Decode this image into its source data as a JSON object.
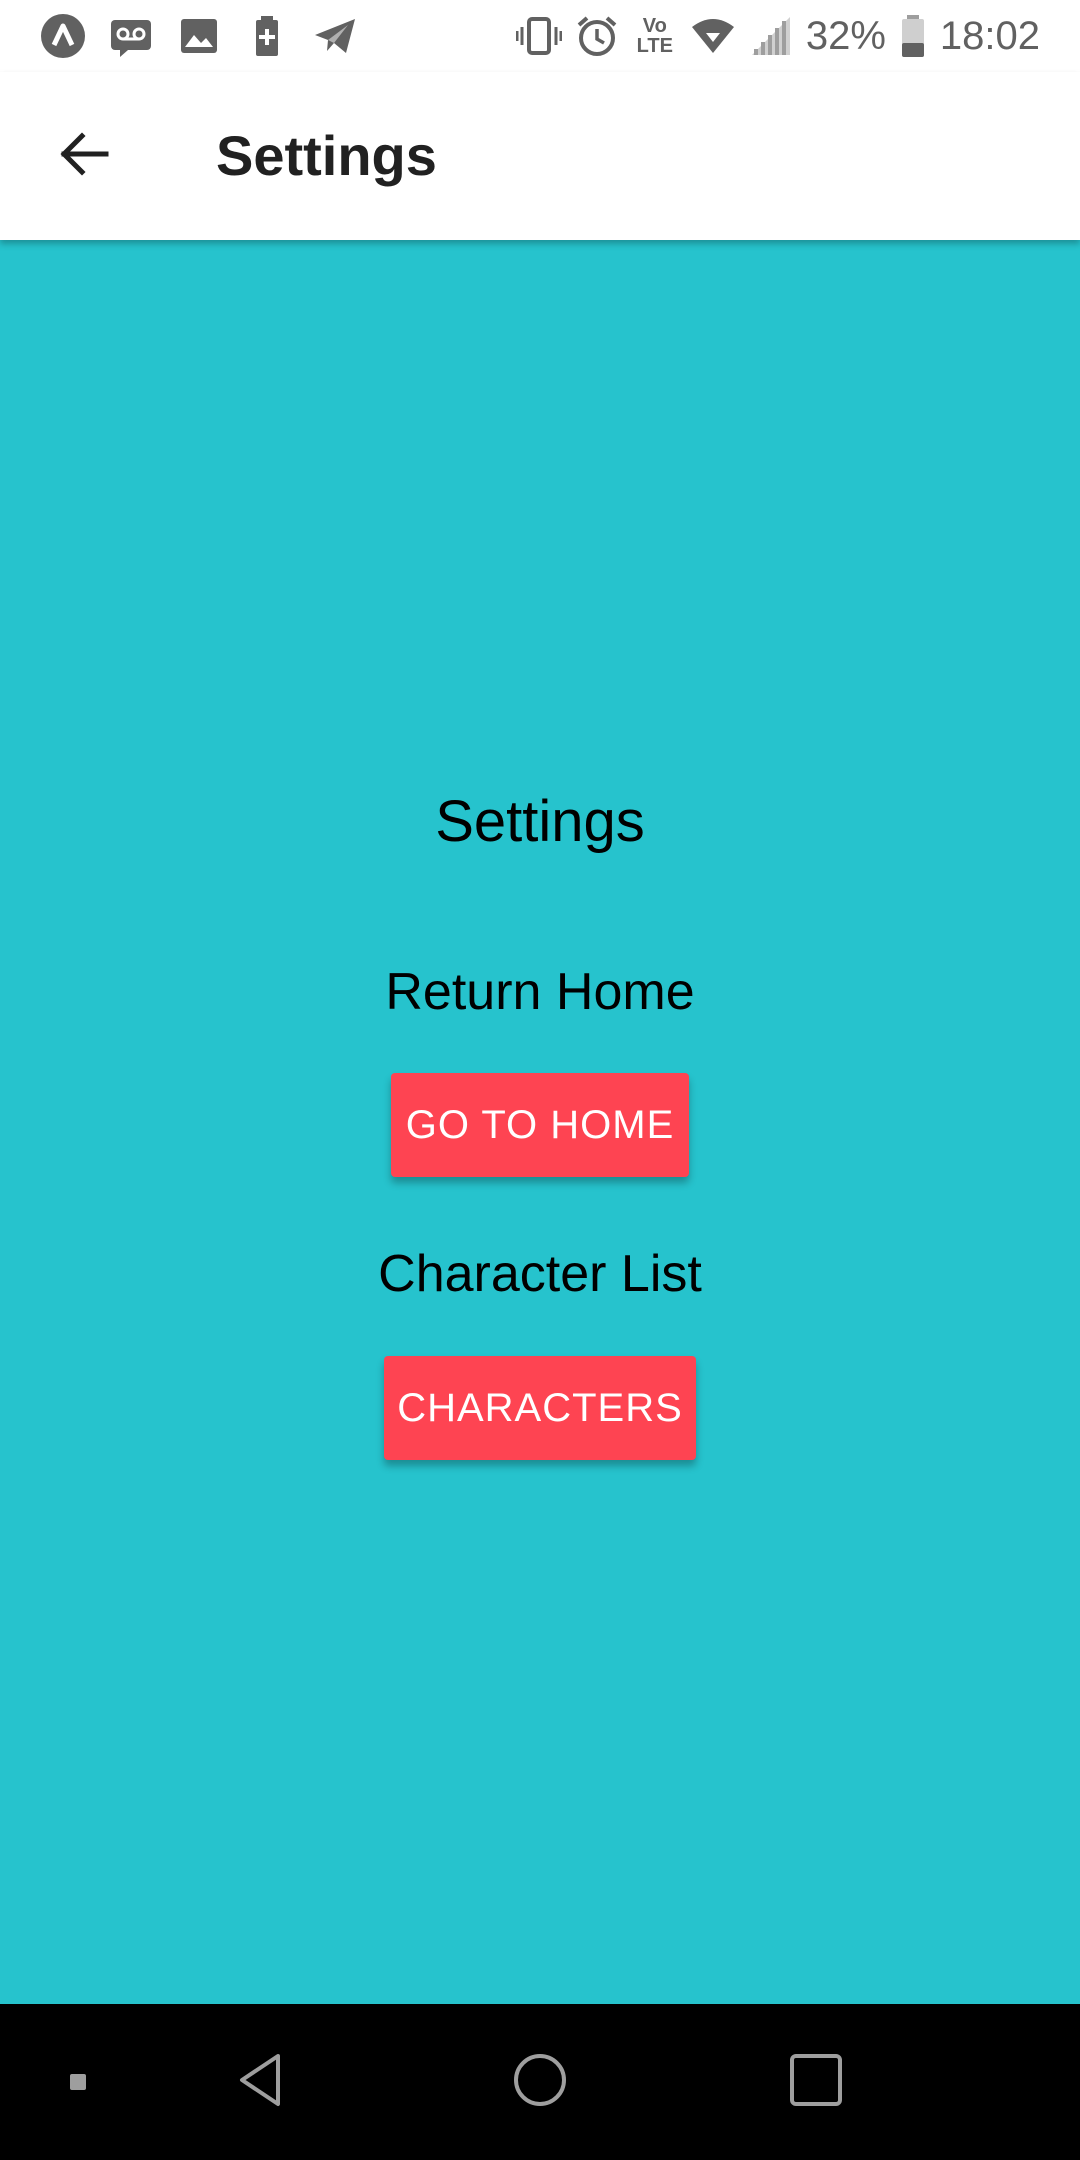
{
  "status_bar": {
    "left_icons": [
      "app-a-icon",
      "voicemail-icon",
      "image-icon",
      "battery-saver-icon",
      "telegram-icon"
    ],
    "right_icons": [
      "vibrate-icon",
      "alarm-icon",
      "volte-icon",
      "wifi-icon",
      "signal-icon",
      "battery-icon"
    ],
    "volte_top": "Vo",
    "volte_bottom": "LTE",
    "battery_percent": "32%",
    "time": "18:02"
  },
  "app_bar": {
    "title": "Settings",
    "back_icon": "arrow-back-icon"
  },
  "main": {
    "title": "Settings",
    "return_home_label": "Return Home",
    "go_home_button": "GO TO HOME",
    "character_list_label": "Character List",
    "characters_button": "CHARACTERS"
  },
  "nav_bar": {
    "icons": [
      "small-square-icon",
      "nav-back-icon",
      "nav-home-icon",
      "nav-recents-icon"
    ]
  },
  "colors": {
    "background": "#26c3cd",
    "button": "#fe4452",
    "app_bar": "#ffffff",
    "nav_bar": "#000000"
  }
}
